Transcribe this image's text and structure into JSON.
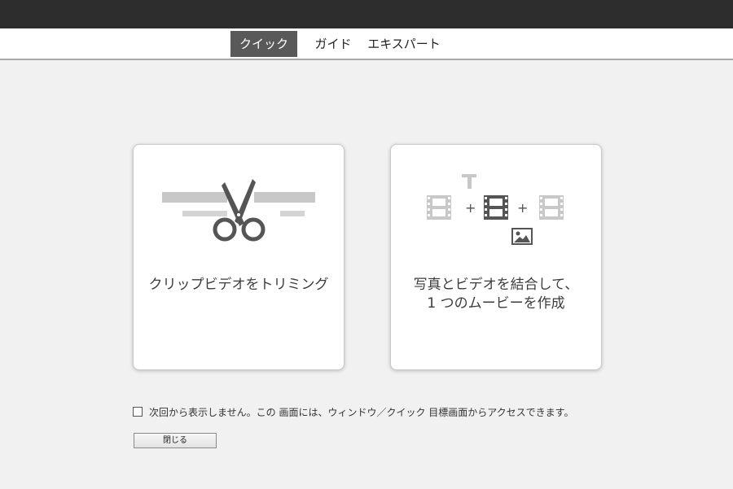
{
  "tabs": [
    {
      "label": "クイック",
      "active": true
    },
    {
      "label": "ガイド",
      "active": false
    },
    {
      "label": "エキスパート",
      "active": false
    }
  ],
  "cards": {
    "trim": {
      "label": "クリップビデオをトリミング",
      "icon": "scissors-icon"
    },
    "combine": {
      "label_line1": "写真とビデオを結合して、",
      "label_line2": "1 つのムービーを作成",
      "icons": [
        "text-icon",
        "film-icon",
        "film-icon",
        "film-icon",
        "image-icon"
      ],
      "plus": "+"
    }
  },
  "footer": {
    "checkbox_checked": false,
    "note": "次回から表示しません。この 画面には、ウィンドウ／クイック 目標画面からアクセスできます。",
    "close_label": "閉じる"
  },
  "colors": {
    "titlebar": "#2d2d2d",
    "active_tab": "#595959",
    "background": "#f1f1f1",
    "icon_dark": "#555555",
    "icon_light": "#c8c8c8"
  }
}
